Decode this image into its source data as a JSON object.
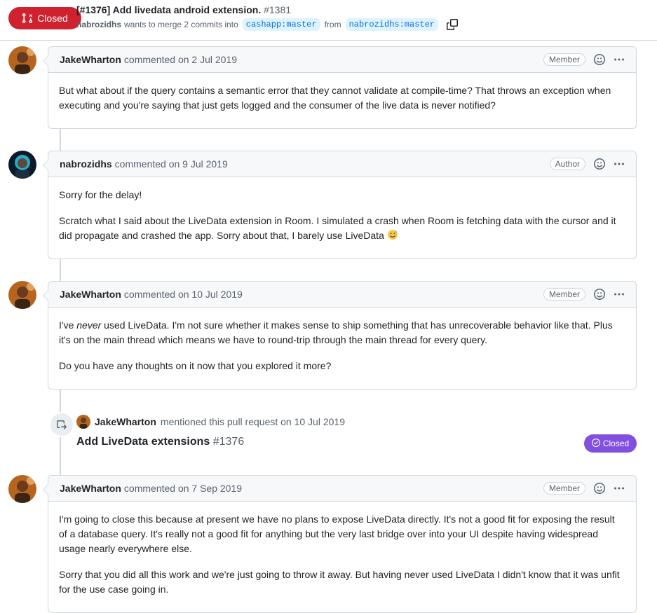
{
  "pr": {
    "state": "Closed",
    "title": "[#1376] Add livedata android extension.",
    "number": "#1381",
    "author": "nabrozidhs",
    "merge_text": "wants to merge 2 commits into",
    "base_branch": "cashapp:master",
    "from_text": "from",
    "head_branch": "nabrozidhs:master"
  },
  "comments": [
    {
      "author": "JakeWharton",
      "meta": "commented on 2 Jul 2019",
      "role": "Member",
      "paragraphs": [
        "But what about if the query contains a semantic error that they cannot validate at compile-time? That throws an exception when executing and you're saying that just gets logged and the consumer of the live data is never notified?"
      ]
    },
    {
      "author": "nabrozidhs",
      "meta": "commented on 9 Jul 2019",
      "role": "Author",
      "paragraphs": [
        "Sorry for the delay!",
        "Scratch what I said about the LiveData extension in Room. I simulated a crash when Room is fetching data with the cursor and it did propagate and crashed the app. Sorry about that, I barely use LiveData"
      ]
    },
    {
      "author": "JakeWharton",
      "meta": "commented on 10 Jul 2019",
      "role": "Member",
      "p1_pre": "I've",
      "p1_em": "never",
      "p1_post": "used LiveData. I'm not sure whether it makes sense to ship something that has unrecoverable behavior like that. Plus it's on the main thread which means we have to round-trip through the main thread for every query.",
      "paragraphs": [
        "Do you have any thoughts on it now that you explored it more?"
      ]
    },
    {
      "author": "JakeWharton",
      "meta": "commented on 7 Sep 2019",
      "role": "Member",
      "paragraphs": [
        "I'm going to close this because at present we have no plans to expose LiveData directly. It's not a good fit for exposing the result of a database query. It's really not a good fit for anything but the very last bridge over into your UI despite having widespread usage nearly everywhere else.",
        "Sorry that you did all this work and we're just going to throw it away. But having never used LiveData I didn't know that it was unfit for the use case going in."
      ]
    }
  ],
  "reference": {
    "author": "JakeWharton",
    "text": "mentioned this pull request on 10 Jul 2019",
    "title": "Add LiveData extensions",
    "number": "#1376",
    "state": "Closed"
  },
  "colors": {
    "closed_red": "#cf222e",
    "closed_purple": "#8250df",
    "branch_bg": "#ddf4ff",
    "branch_fg": "#0969da"
  },
  "icons": {
    "state": "git-pull-request-closed-icon",
    "copy": "copy-icon",
    "reaction": "smiley-icon",
    "more": "kebab-horizontal-icon",
    "reference": "cross-reference-icon",
    "closed_pill": "circle-check-icon"
  }
}
